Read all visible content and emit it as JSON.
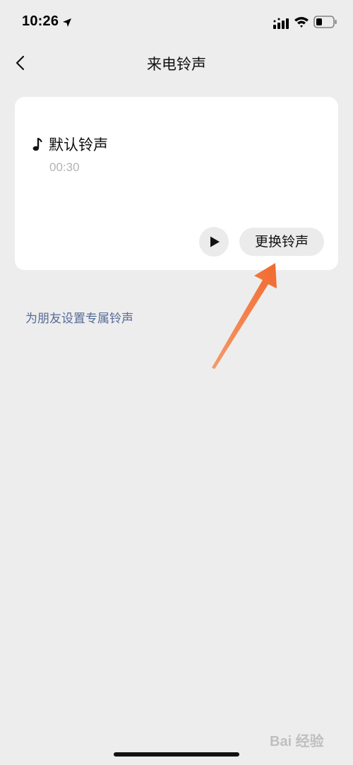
{
  "status_bar": {
    "time": "10:26",
    "icons": [
      "location-arrow-icon",
      "cellular-signal-icon",
      "wifi-icon",
      "battery-icon"
    ]
  },
  "nav": {
    "back_icon": "chevron-left-icon",
    "title": "来电铃声"
  },
  "ringtone_card": {
    "icon": "music-note-icon",
    "name": "默认铃声",
    "duration": "00:30",
    "play_icon": "play-icon",
    "change_button_label": "更换铃声"
  },
  "friend_link": {
    "label": "为朋友设置专属铃声"
  },
  "watermark": {
    "text": "Bai 经验"
  },
  "colors": {
    "background": "#ededed",
    "card": "#ffffff",
    "button_bg": "#ebebeb",
    "link": "#576b95",
    "arrow_annotation": "#f26a2e",
    "secondary_text": "#b3b3b3"
  }
}
